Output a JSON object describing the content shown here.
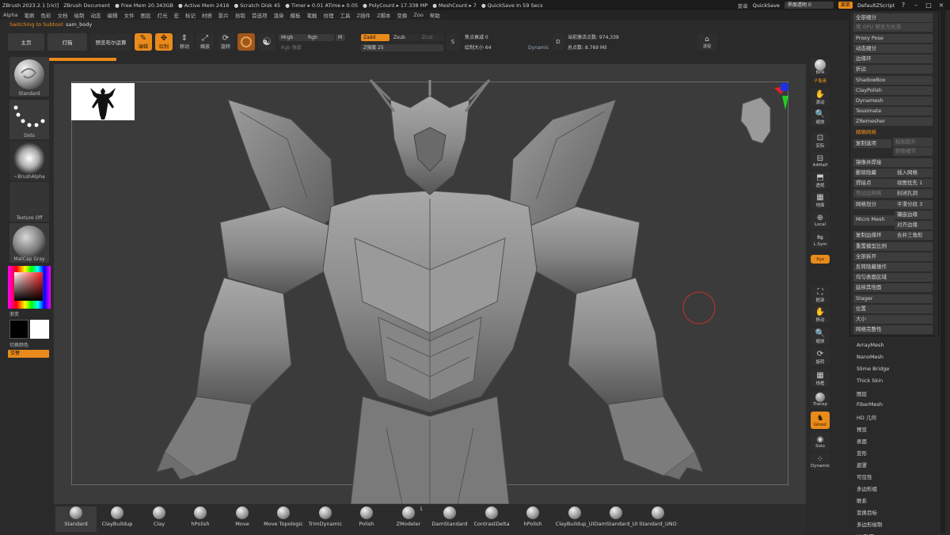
{
  "titlebar": {
    "segments": [
      "ZBrush 2023.2.1 [ricl]",
      "ZBrush Document",
      "● Free Mem 20.343GB",
      "● Active Mem 2416",
      "● Scratch Disk 45",
      "● Timer ▸ 0.01 ATime ▸ 0.05",
      "● PolyCount ▸ 17.338 MP",
      "● MeshCount ▸ 7",
      "● QuickSave In 59 Secs"
    ],
    "right": {
      "menus_label": "菜单",
      "quicksave": "QuickSave",
      "opacity_label": "界面透明 0",
      "menu_pill": "菜单",
      "script": "DefaultZScript",
      "help": "?"
    }
  },
  "menubar": [
    "Alpha",
    "笔刷",
    "色彩",
    "文档",
    "绘制",
    "动态",
    "编辑",
    "文件",
    "图层",
    "灯光",
    "宏",
    "标记",
    "材质",
    "影片",
    "拾取",
    "首选项",
    "渲染",
    "模板",
    "笔触",
    "纹理",
    "工具",
    "Z插件",
    "Z脚本",
    "变换",
    "Zoo",
    "帮助"
  ],
  "status": {
    "prefix": "Switching to Subtool",
    "name": "sam_body"
  },
  "toolbar": {
    "home": "主页",
    "lightbox": "灯箱",
    "preview": "预览布尔运算",
    "edit": "编辑",
    "draw": "绘制",
    "move": "移动",
    "scale": "缩放",
    "rotate": "旋转",
    "mrgb": "Mrgb",
    "rgb": "Rgb",
    "m": "M",
    "rgb_strength": "Rgb 强度",
    "zadd": "Zadd",
    "zsub": "Zsub",
    "zcut": "Zcut",
    "z_intensity": "Z强度 25",
    "focal_shift": "焦点衰减 0",
    "draw_size": "绘制大小 64",
    "dynamic": "Dynamic",
    "active_points": "当前激活点数: 974,339",
    "total_points": "总点数: 8.769 Mil",
    "perspective": "透视"
  },
  "leftpanel": {
    "brush": "Standard",
    "stroke": "Dots",
    "alpha": "~BrushAlpha",
    "texture": "Texture Off",
    "material": "MatCap Gray",
    "gradient": "渐变",
    "switch_color": "切换颜色",
    "alternate": "交替"
  },
  "rightcol": {
    "labels": [
      "BPR",
      "子像素",
      "滚动",
      "缩放",
      "实际",
      "AAHalf",
      "透视",
      "地面",
      "Local",
      "L.Sym",
      "Xyz",
      "框架",
      "移动",
      "缩放",
      "旋转",
      "线框",
      "Transp",
      "Ghost",
      "Solo",
      "Dynamic"
    ],
    "xyz": "Xyz"
  },
  "rpanel": {
    "items": [
      "全部细分",
      "用 GPU 预览为光滑",
      "Proxy Pose",
      "动态细分",
      "边缘环",
      "折边",
      "ShadowBox",
      "ClayPolish",
      "Dynamesh",
      "Tessimate",
      "ZRemesher",
      "精确网格",
      "复制选项",
      "粘贴拓扑",
      "转移细节",
      "镜像并焊接",
      "删除隐藏",
      "插入网格",
      "焊接点",
      "视图优先 1",
      "等边边网格",
      "封闭孔洞",
      "网格划分",
      "平滑分段 3",
      "Micro Mesh",
      "镶嵌边缘",
      "对齐边缘",
      "复制边缘环",
      "合并三角形",
      "重置模型比例",
      "全部拆开",
      "反转隐藏操作",
      "均匀表面区域",
      "延续其他面",
      "Stager",
      "位置",
      "大小",
      "网格完整性"
    ],
    "list": [
      "ArrayMesh",
      "NanoMesh",
      "Slime Bridge",
      "Thick Skin",
      "图层",
      "FiberMesh",
      "HD 几何",
      "预览",
      "表面",
      "变形",
      "遮罩",
      "可见性",
      "多边形组",
      "联系",
      "变换目标",
      "多边形绘制",
      "UV贴图"
    ]
  },
  "brushes": [
    "Standard",
    "ClayBuildup",
    "Clay",
    "hPolish",
    "Move",
    "Move Topologic",
    "TrimDynamic",
    "Polish",
    "ZModeler",
    "DamStandard",
    "ContrastDelta",
    "hPolish",
    "ClayBuildup_UI",
    "DamStandard_UI",
    "Standard_UNO"
  ],
  "zmodeler_count": "1",
  "colors": {
    "accent": "#e98a1c",
    "panel": "#2b2b2b",
    "canvas": "#3b3b3b"
  }
}
